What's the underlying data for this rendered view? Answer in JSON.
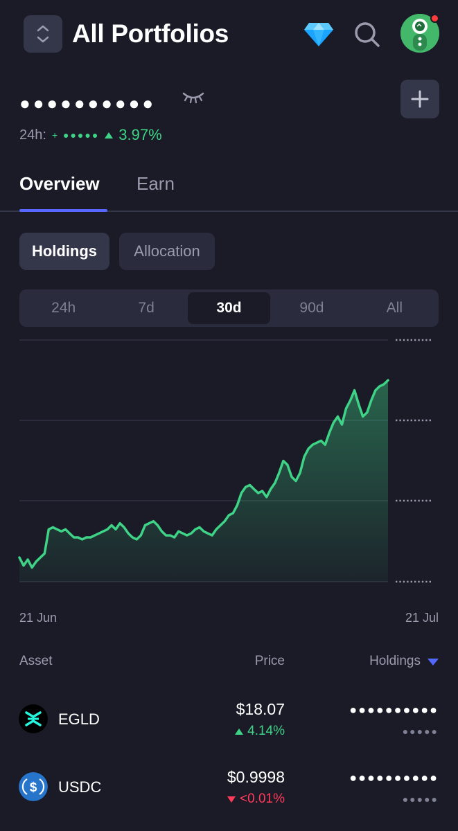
{
  "header": {
    "title": "All Portfolios",
    "icons": [
      "chevron-up-down-icon",
      "diamond-icon",
      "search-icon",
      "avatar"
    ]
  },
  "balance": {
    "masked_value": "●●●●●●●●●●",
    "change_label": "24h:",
    "change_masked": "+ ●●●●●",
    "change_pct": "3.97%"
  },
  "tabs": [
    {
      "label": "Overview",
      "active": true
    },
    {
      "label": "Earn",
      "active": false
    }
  ],
  "view_toggle": {
    "holdings": "Holdings",
    "allocation": "Allocation"
  },
  "ranges": [
    {
      "label": "24h",
      "active": false
    },
    {
      "label": "7d",
      "active": false
    },
    {
      "label": "30d",
      "active": true
    },
    {
      "label": "90d",
      "active": false
    },
    {
      "label": "All",
      "active": false
    }
  ],
  "chart_data": {
    "type": "area",
    "x_start": "21 Jun",
    "x_end": "21 Jul",
    "values": [
      12,
      8,
      11,
      7,
      10,
      12,
      14,
      26,
      27,
      26,
      25,
      26,
      24,
      22,
      22,
      21,
      22,
      22,
      23,
      24,
      25,
      26,
      28,
      26,
      29,
      27,
      24,
      22,
      21,
      23,
      28,
      29,
      30,
      28,
      25,
      23,
      23,
      22,
      25,
      24,
      23,
      24,
      26,
      27,
      25,
      24,
      23,
      26,
      28,
      30,
      33,
      34,
      38,
      44,
      47,
      48,
      46,
      44,
      45,
      42,
      46,
      49,
      54,
      60,
      58,
      52,
      50,
      54,
      62,
      66,
      68,
      69,
      70,
      68,
      74,
      79,
      82,
      78,
      86,
      90,
      95,
      88,
      82,
      84,
      90,
      95,
      97,
      98,
      100
    ],
    "ylim": [
      0,
      110
    ],
    "grid": true,
    "accent": "#3ed387"
  },
  "table": {
    "headers": {
      "asset": "Asset",
      "price": "Price",
      "holdings": "Holdings"
    },
    "rows": [
      {
        "symbol": "EGLD",
        "price": "$18.07",
        "change": "4.14%",
        "direction": "up",
        "holdings": "●●●●●●●●●●",
        "holdings_sub": "●●●●●"
      },
      {
        "symbol": "USDC",
        "price": "$0.9998",
        "change": "<0.01%",
        "direction": "down",
        "holdings": "●●●●●●●●●●",
        "holdings_sub": "●●●●●"
      }
    ]
  },
  "colors": {
    "background": "#1a1b26",
    "surface": "#34364a",
    "positive": "#3ed387",
    "negative": "#ff3b5c",
    "accent_blue": "#5468ff"
  }
}
